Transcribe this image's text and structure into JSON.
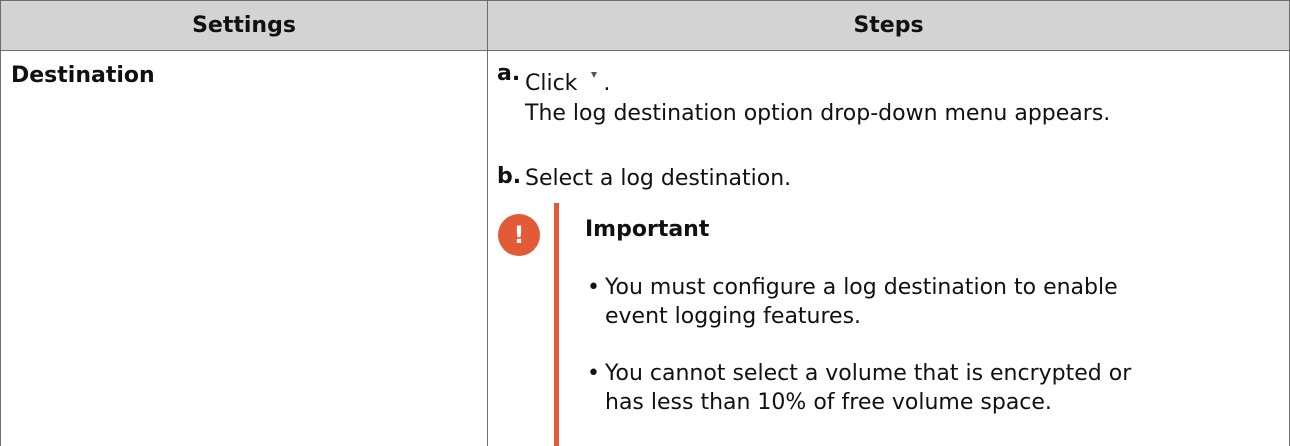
{
  "table": {
    "headers": {
      "settings": "Settings",
      "steps": "Steps"
    },
    "rows": [
      {
        "setting": "Destination",
        "steps": {
          "a": {
            "letter": "a.",
            "click_text": "Click",
            "click_suffix": ".",
            "icon": "dropdown-arrow-icon",
            "result": "The log destination option drop-down menu appears."
          },
          "b": {
            "letter": "b.",
            "text": "Select a log destination."
          },
          "note": {
            "icon": "important-icon",
            "icon_glyph": "!",
            "title": "Important",
            "bullet": "•",
            "items": [
              {
                "line1": "You must configure a log destination to enable",
                "line2": "event logging features."
              },
              {
                "line1": "You cannot select a volume that is encrypted or",
                "line2": "has less than 10% of free volume space."
              }
            ]
          }
        }
      }
    ]
  },
  "colors": {
    "header_bg": "#d3d3d3",
    "important_accent": "#e35a36",
    "border": "#6e6e6e"
  }
}
